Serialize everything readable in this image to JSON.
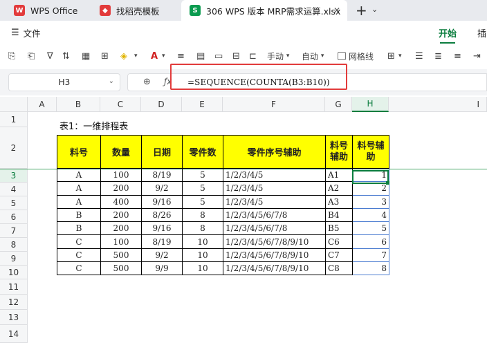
{
  "tabs": [
    {
      "label": "WPS Office",
      "icon": "wps-logo-icon",
      "color": "#e23b3b"
    },
    {
      "label": "找稻壳模板",
      "icon": "docer-icon",
      "color": "#e23b3b"
    },
    {
      "label": "306 WPS 版本 MRP需求运算.xlsx",
      "icon": "spreadsheet-icon",
      "color": "#0a9b4f"
    }
  ],
  "menu": {
    "file_label": "文件",
    "start_tab": "开始",
    "insert_tab": "插"
  },
  "toolbar": {
    "manual_label": "手动",
    "auto_label": "自动",
    "gridlines_label": "网格线"
  },
  "formula_bar": {
    "cell_ref": "H3",
    "formula": "=SEQUENCE(COUNTA(B3:B10))"
  },
  "sheet": {
    "columns": [
      "A",
      "B",
      "C",
      "D",
      "E",
      "F",
      "G",
      "H",
      "I"
    ],
    "rows": [
      "1",
      "2",
      "3",
      "4",
      "5",
      "6",
      "7",
      "8",
      "9",
      "10",
      "11",
      "12",
      "13",
      "14"
    ],
    "selected_column": "H",
    "selected_row": "3",
    "title": "表1：一维排程表",
    "headers": [
      "料号",
      "数量",
      "日期",
      "零件数",
      "零件序号辅助",
      "料号辅助",
      "料号辅助"
    ],
    "data": [
      [
        "A",
        "100",
        "8/19",
        "5",
        "1/2/3/4/5",
        "A1",
        "1"
      ],
      [
        "A",
        "200",
        "9/2",
        "5",
        "1/2/3/4/5",
        "A2",
        "2"
      ],
      [
        "A",
        "400",
        "9/16",
        "5",
        "1/2/3/4/5",
        "A3",
        "3"
      ],
      [
        "B",
        "200",
        "8/26",
        "8",
        "1/2/3/4/5/6/7/8",
        "B4",
        "4"
      ],
      [
        "B",
        "200",
        "9/16",
        "8",
        "1/2/3/4/5/6/7/8",
        "B5",
        "5"
      ],
      [
        "C",
        "100",
        "8/19",
        "10",
        "1/2/3/4/5/6/7/8/9/10",
        "C6",
        "6"
      ],
      [
        "C",
        "500",
        "9/2",
        "10",
        "1/2/3/4/5/6/7/8/9/10",
        "C7",
        "7"
      ],
      [
        "C",
        "500",
        "9/9",
        "10",
        "1/2/3/4/5/6/7/8/9/10",
        "C8",
        "8"
      ]
    ]
  },
  "colors": {
    "accent": "#0a7d3e",
    "header_fill": "#ffff00",
    "highlight_box": "#e23b3b"
  }
}
